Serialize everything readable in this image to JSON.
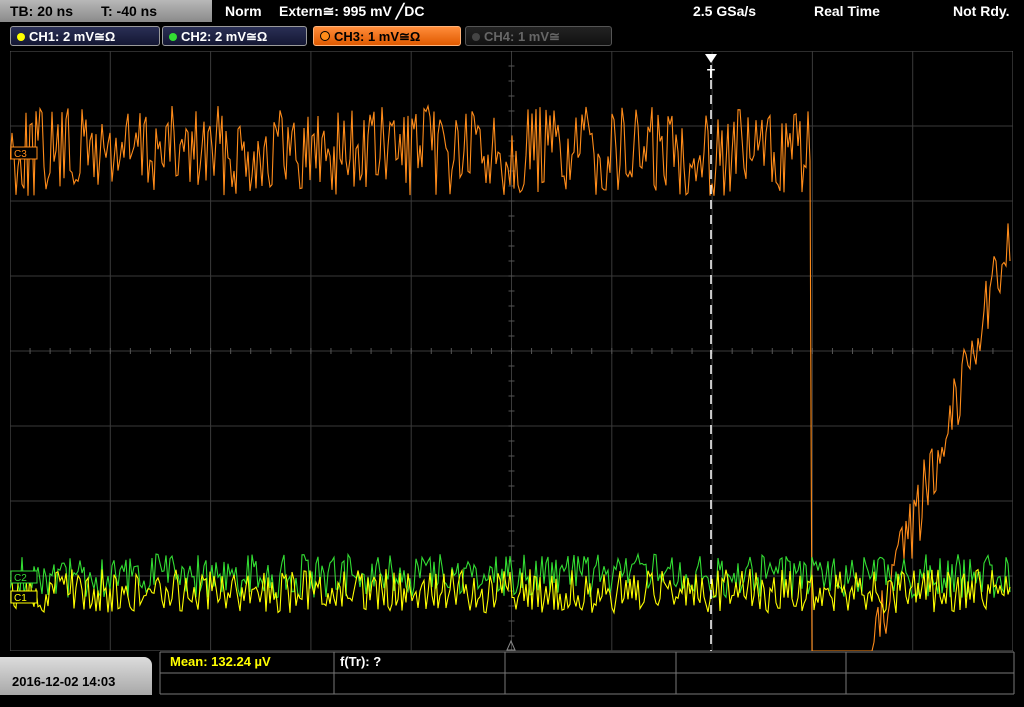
{
  "timebase": {
    "tb_label": "TB: 20 ns",
    "trig_offset_label": "T: -40 ns"
  },
  "status": {
    "mode": "Norm",
    "trigger": "Extern≅: 995 mV ╱DC",
    "sample_rate": "2.5 GSa/s",
    "acq_mode": "Real Time",
    "ready": "Not Rdy."
  },
  "channels": [
    {
      "label": "CH1: 2 mV≅Ω",
      "color": "#ffff00",
      "state": "on"
    },
    {
      "label": "CH2: 2 mV≅Ω",
      "color": "#33dd33",
      "state": "on"
    },
    {
      "label": "CH3: 1 mV≅Ω",
      "color": "#ff8c1a",
      "state": "active"
    },
    {
      "label": "CH4: 1 mV≅",
      "color": "#555555",
      "state": "off"
    }
  ],
  "markers": {
    "ch3_marker": "C3",
    "ch2_marker": "C2",
    "ch1_marker": "C1",
    "trigger_marker": "T"
  },
  "footer": {
    "datetime": "2016-12-02 14:03",
    "measurement_1": "Mean: 132.24 µV",
    "measurement_2": "f(Tr): ?"
  },
  "colors": {
    "ch1": "#ffff00",
    "ch2": "#33dd33",
    "ch3": "#ff8c1a",
    "grid": "#3a3a3a",
    "measurement": "#ffff00"
  }
}
